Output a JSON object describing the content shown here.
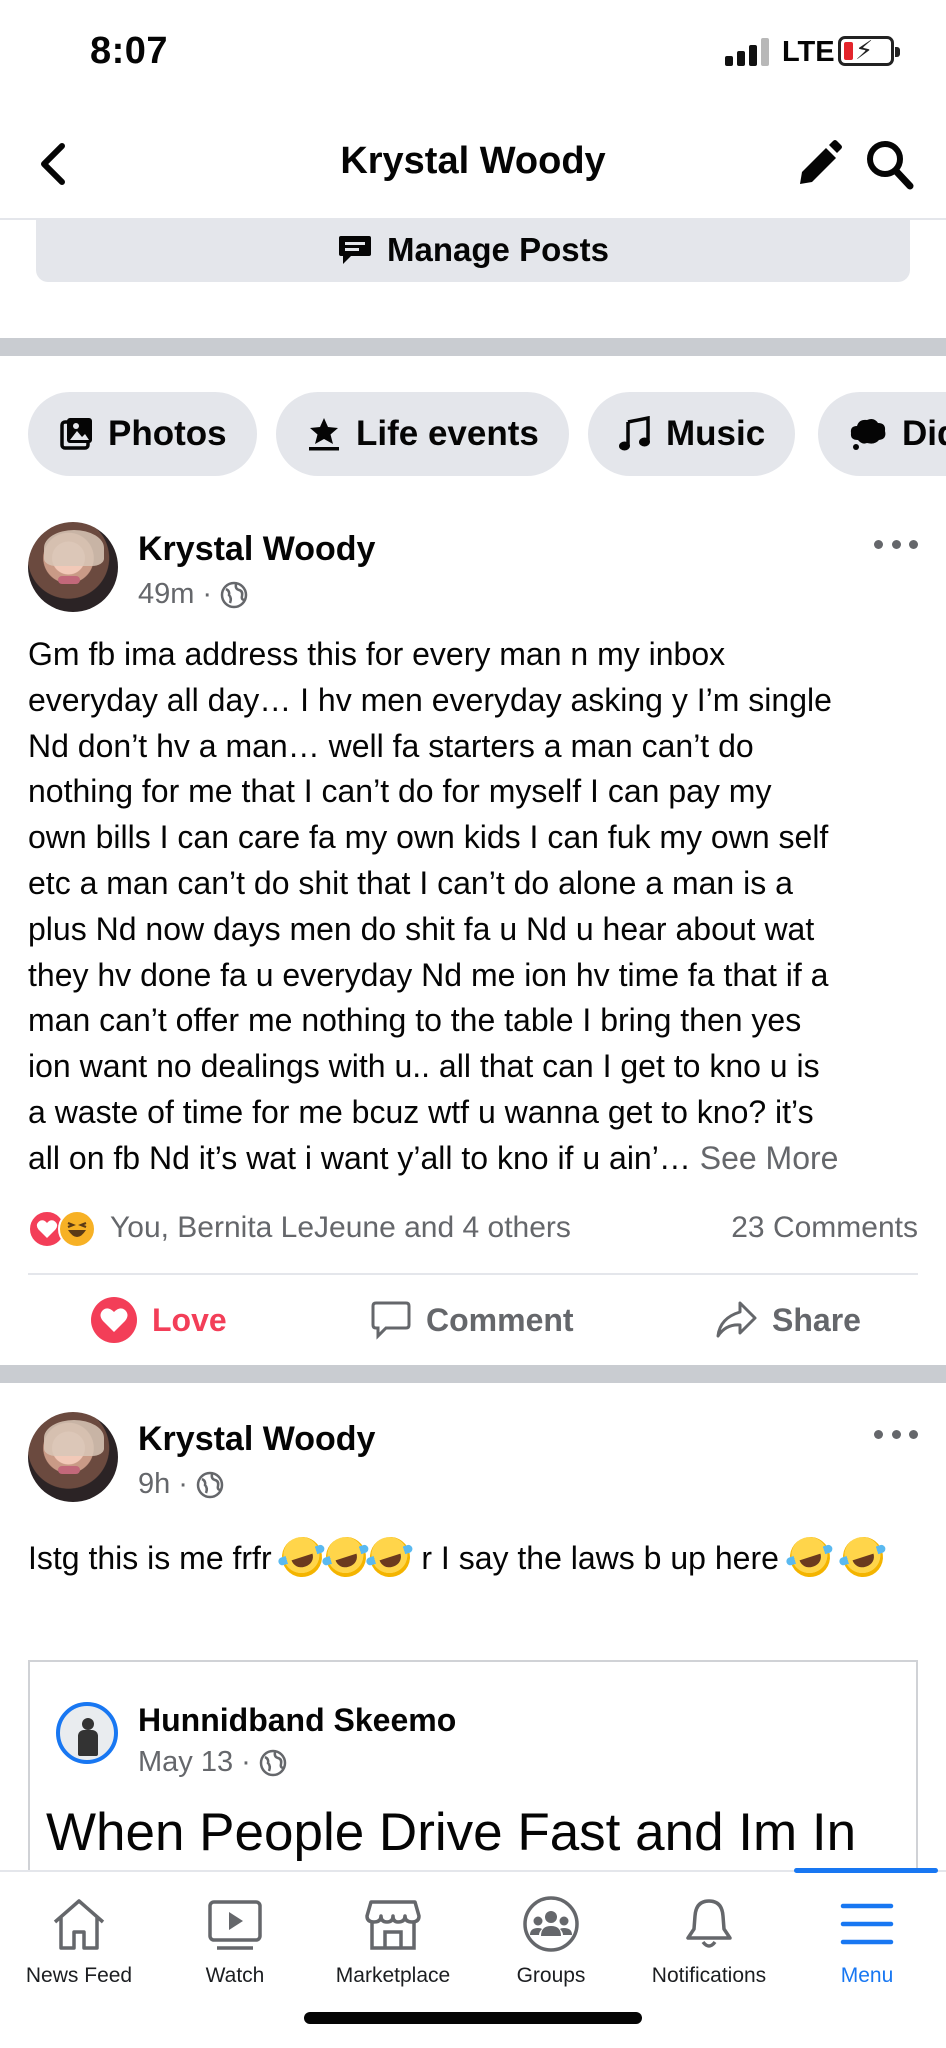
{
  "status_bar": {
    "time": "8:07",
    "network": "LTE"
  },
  "header": {
    "title": "Krystal Woody",
    "back_icon": "chevron-left-icon",
    "edit_icon": "pencil-icon",
    "search_icon": "search-icon"
  },
  "manage_posts": {
    "label": "Manage Posts",
    "icon": "manage-posts-icon"
  },
  "chips": [
    {
      "label": "Photos",
      "icon": "photos-icon"
    },
    {
      "label": "Life events",
      "icon": "life-events-icon"
    },
    {
      "label": "Music",
      "icon": "music-note-icon"
    },
    {
      "label": "Did",
      "icon": "thought-bubble-icon"
    }
  ],
  "post1": {
    "author": "Krystal Woody",
    "time": "49m",
    "lines": [
      "Gm fb ima address this for every man n my inbox",
      "everyday all day… I hv men everyday asking y I’m single",
      "Nd don’t hv a man… well fa starters a man can’t do",
      "nothing for me that I can’t do for myself I can pay my",
      "own bills I can care fa my own kids I can fuk my own self",
      "etc a man can’t do shit that I can’t do alone a man is a",
      "plus Nd now days men do shit fa u Nd u hear about wat",
      "they hv done fa u everyday Nd me ion hv time fa that if a",
      "man can’t offer me nothing to the table I bring then yes",
      "ion want no dealings with u.. all that can I get to kno u is",
      "a waste of time for me bcuz wtf u wanna get to kno? it’s",
      "all on fb Nd it’s wat i want y’all to kno if u ain’…"
    ],
    "see_more": "See More",
    "reactions_text": "You, Bernita LeJeune and 4 others",
    "comments": "23 Comments",
    "actions": {
      "love": "Love",
      "comment": "Comment",
      "share": "Share"
    }
  },
  "post2": {
    "author": "Krystal Woody",
    "time": "9h",
    "text_a": "Istg this is me frfr",
    "text_b": "r I say the laws b up here",
    "shared": {
      "author": "Hunnidband Skeemo",
      "date": "May 13",
      "headline": "When People Drive Fast and Im In"
    }
  },
  "bottom_nav": [
    {
      "label": "News Feed",
      "icon": "home-icon"
    },
    {
      "label": "Watch",
      "icon": "watch-icon"
    },
    {
      "label": "Marketplace",
      "icon": "marketplace-icon"
    },
    {
      "label": "Groups",
      "icon": "groups-icon"
    },
    {
      "label": "Notifications",
      "icon": "bell-icon"
    },
    {
      "label": "Menu",
      "icon": "menu-icon",
      "active": true
    }
  ],
  "colors": {
    "accent": "#1877f2",
    "love": "#f33e58",
    "secondary_text": "#65676b",
    "chip_bg": "#e4e6eb"
  }
}
